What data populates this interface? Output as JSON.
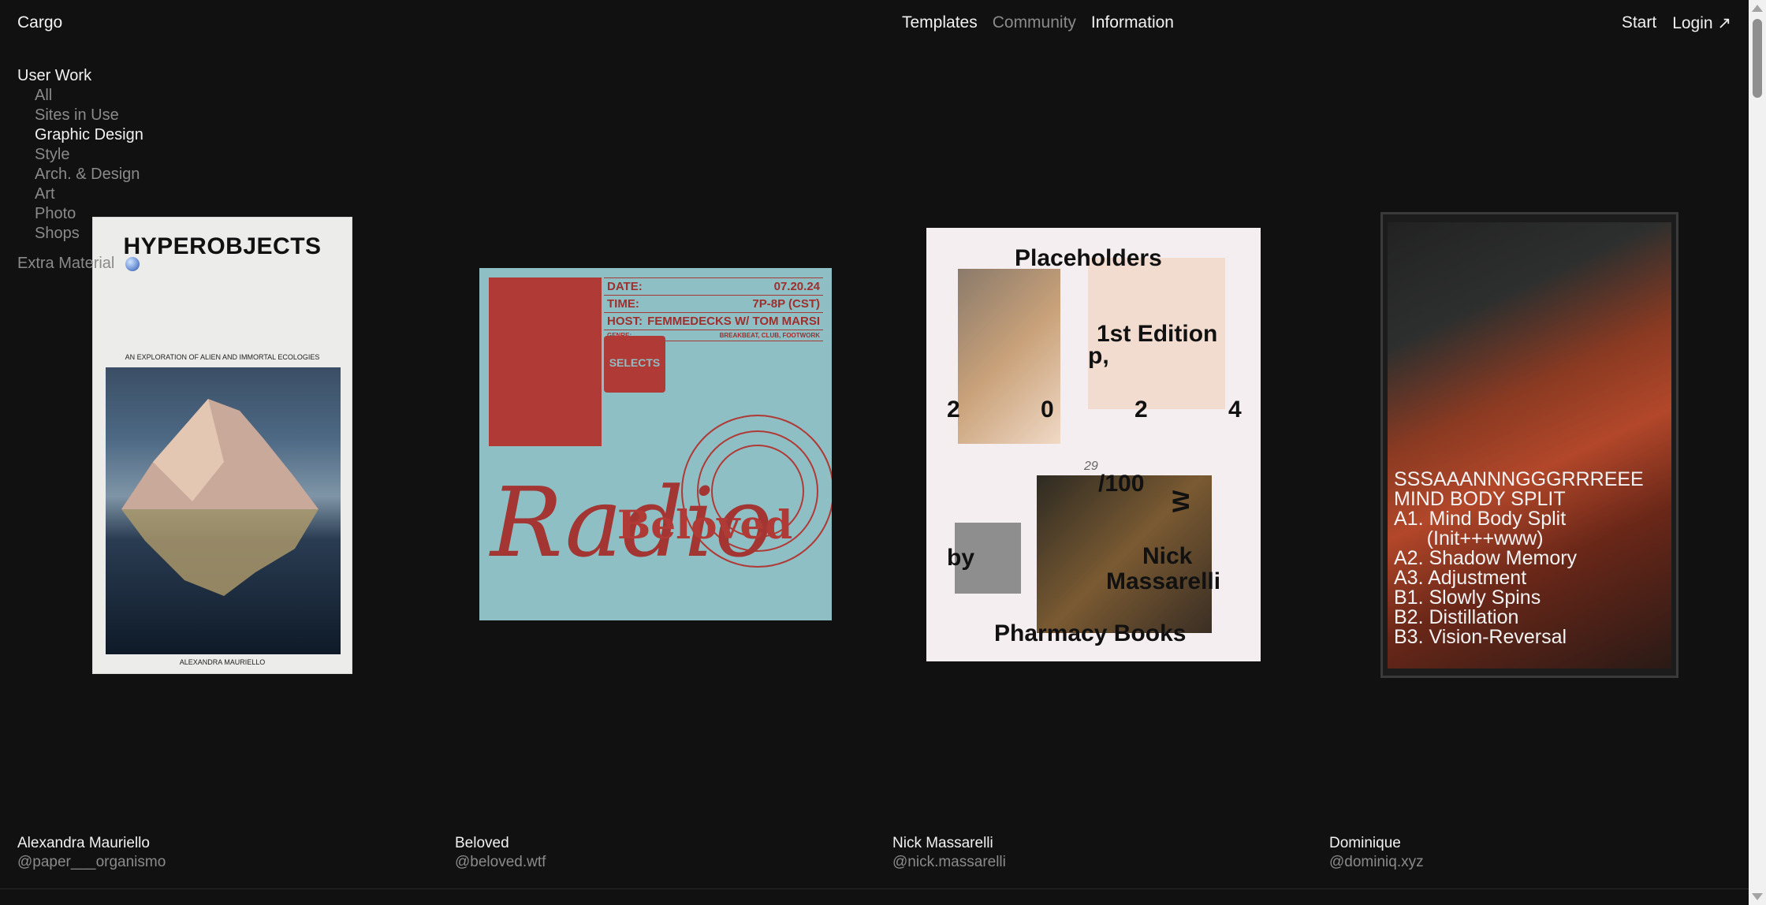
{
  "header": {
    "logo": "Cargo",
    "nav_center": [
      "Templates",
      "Community",
      "Information"
    ],
    "nav_right": [
      "Start",
      "Login ↗"
    ]
  },
  "sidebar": {
    "section": "User Work",
    "items": [
      "All",
      "Sites in Use",
      "Graphic Design",
      "Style",
      "Arch. & Design",
      "Art",
      "Photo",
      "Shops"
    ],
    "active_item": "Graphic Design",
    "extra": "Extra Material"
  },
  "cards": [
    {
      "name": "Alexandra Mauriello",
      "handle": "@paper___organismo",
      "book_title": "HYPEROBJECTS",
      "book_subtitle": "AN EXPLORATION OF ALIEN AND IMMORTAL ECOLOGIES",
      "book_author": "ALEXANDRA MAURIELLO"
    },
    {
      "name": "Beloved",
      "handle": "@beloved.wtf",
      "rows": [
        {
          "k": "DATE:",
          "v": "07.20.24"
        },
        {
          "k": "TIME:",
          "v": "7P-8P (CST)"
        },
        {
          "k": "HOST:",
          "v": "FEMMEDECKS W/ TOM MARSI"
        },
        {
          "k": "GENRE:",
          "v": "BREAKBEAT, CLUB, FOOTWORK"
        }
      ],
      "stamp": "SELECTS",
      "logo": "Beloved",
      "script": "Radio"
    },
    {
      "name": "Nick Massarelli",
      "handle": "@nick.massarelli",
      "lines": {
        "title": "Placeholders",
        "edition": "1st Edition",
        "p": "p,",
        "year": [
          "2",
          "0",
          "2",
          "4"
        ],
        "count": "/100",
        "count_hand": "29",
        "by": "by",
        "w": "W",
        "author1": "Nick",
        "author2": "Massarelli",
        "publisher": "Pharmacy Books"
      }
    },
    {
      "name": "Dominique",
      "handle": "@dominiq.xyz",
      "tracklist": "SSSAAANNNGGGRRREEE\nMIND BODY SPLIT\nA1. Mind Body Split\n      (Init+++www)\nA2. Shadow Memory\nA3. Adjustment\nB1. Slowly Spins\nB2. Distillation\nB3. Vision-Reversal"
    }
  ]
}
